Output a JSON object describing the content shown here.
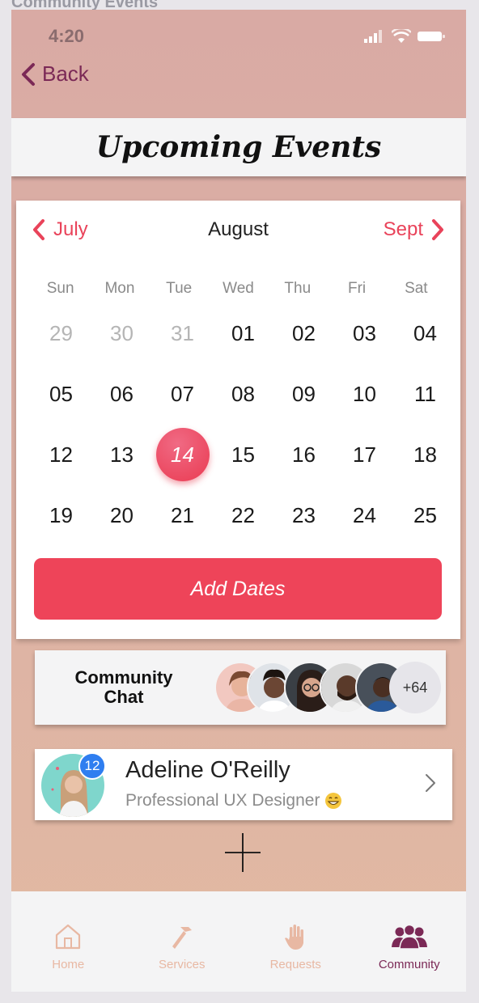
{
  "page_caption": "Community Events",
  "status_bar": {
    "time": "4:20"
  },
  "nav": {
    "back_label": "Back"
  },
  "header": {
    "title": "Upcoming Events"
  },
  "calendar": {
    "prev_month": "July",
    "current_month": "August",
    "next_month": "Sept",
    "weekdays": [
      "Sun",
      "Mon",
      "Tue",
      "Wed",
      "Thu",
      "Fri",
      "Sat"
    ],
    "weeks": [
      [
        "29",
        "30",
        "31",
        "01",
        "02",
        "03",
        "04"
      ],
      [
        "05",
        "06",
        "07",
        "08",
        "09",
        "10",
        "11"
      ],
      [
        "12",
        "13",
        "14",
        "15",
        "16",
        "17",
        "18"
      ],
      [
        "19",
        "20",
        "21",
        "22",
        "23",
        "24",
        "25"
      ]
    ],
    "muted_days": [
      "29",
      "30",
      "31"
    ],
    "selected_day": "14",
    "add_dates_label": "Add Dates"
  },
  "community_chat": {
    "title_line1": "Community",
    "title_line2": "Chat",
    "more_count": "+64"
  },
  "profile": {
    "name": "Adeline O'Reilly",
    "subtitle": "Professional UX Designer",
    "badge_count": "12"
  },
  "tabs": [
    {
      "label": "Home",
      "icon": "home-icon"
    },
    {
      "label": "Services",
      "icon": "hammer-icon"
    },
    {
      "label": "Requests",
      "icon": "hand-icon"
    },
    {
      "label": "Community",
      "icon": "people-icon"
    }
  ],
  "colors": {
    "accent": "#ee4459",
    "brand": "#7b2956",
    "badge": "#2f7ef0",
    "tab_inactive": "#e8b8a3"
  }
}
